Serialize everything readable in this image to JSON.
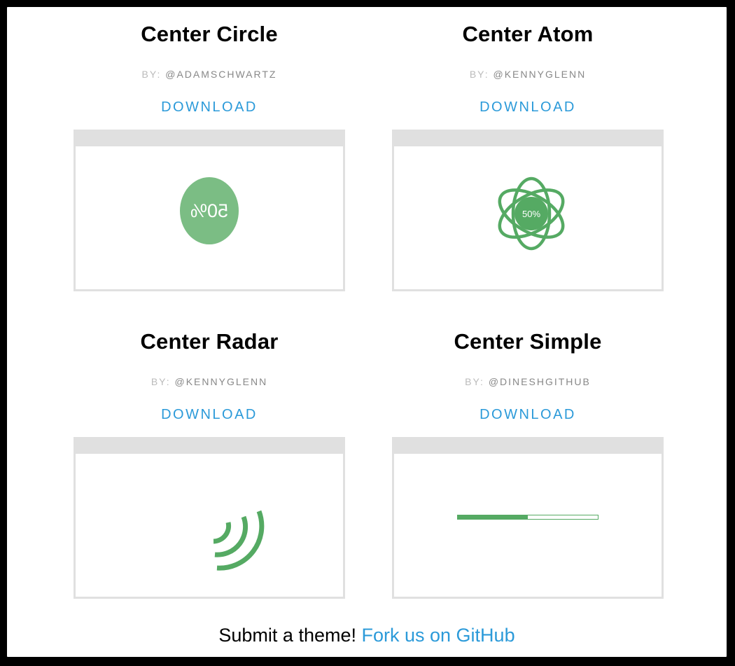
{
  "themes": [
    {
      "title": "Center Circle",
      "by_label": "BY:",
      "author": "@ADAMSCHWARTZ",
      "download": "DOWNLOAD",
      "progress_text": "50%",
      "progress": 0.5
    },
    {
      "title": "Center Atom",
      "by_label": "BY:",
      "author": "@KENNYGLENN",
      "download": "DOWNLOAD",
      "progress_text": "50%",
      "progress": 0.5
    },
    {
      "title": "Center Radar",
      "by_label": "BY:",
      "author": "@KENNYGLENN",
      "download": "DOWNLOAD",
      "progress": 0.5
    },
    {
      "title": "Center Simple",
      "by_label": "BY:",
      "author": "@DINESHGITHUB",
      "download": "DOWNLOAD",
      "progress": 0.5
    }
  ],
  "footer": {
    "text": "Submit a theme!",
    "link": "Fork us on GitHub"
  },
  "colors": {
    "accent": "#2b9ad9",
    "progress_green": "#55aa63",
    "circle_green": "#7bbd84",
    "preview_border": "#e0e0e0"
  }
}
